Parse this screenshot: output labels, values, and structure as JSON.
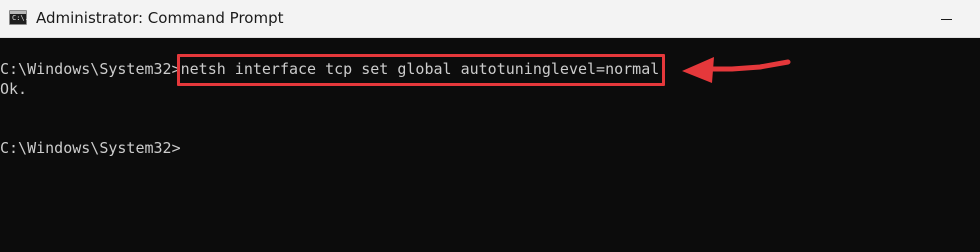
{
  "window": {
    "title": "Administrator: Command Prompt",
    "icon": "command-prompt-icon",
    "icon_glyph": "C:\\.",
    "controls": [
      "minimize-icon"
    ]
  },
  "console": {
    "lines": [
      {
        "prompt": "C:\\Windows\\System32>",
        "command": "netsh interface tcp set global autotuninglevel=normal"
      },
      {
        "output": "Ok."
      },
      {
        "prompt": "C:\\Windows\\System32>",
        "command": ""
      }
    ]
  },
  "annotation": {
    "highlight_color": "#e5383b",
    "arrow_color": "#e5383b",
    "target": "command highlight"
  },
  "colors": {
    "console_bg": "#0c0c0c",
    "console_text": "#cccccc",
    "titlebar_bg": "#f3f3f3"
  }
}
